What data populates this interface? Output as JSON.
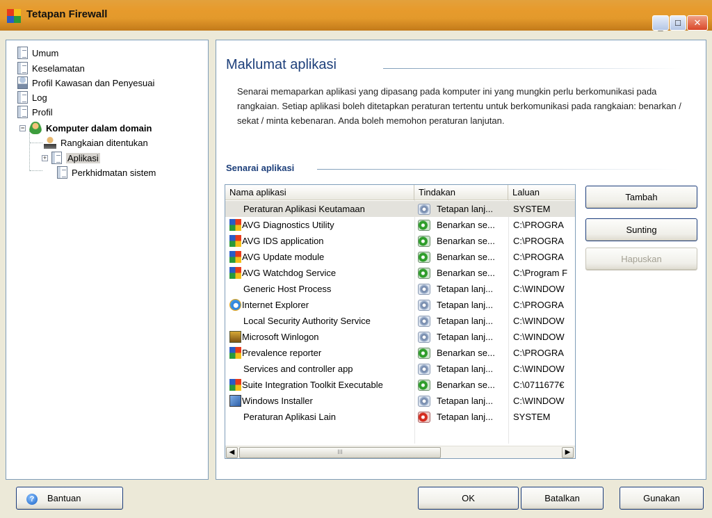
{
  "window": {
    "title": "Tetapan Firewall"
  },
  "tree": {
    "items": [
      {
        "label": "Umum"
      },
      {
        "label": "Keselamatan"
      },
      {
        "label": "Profil Kawasan dan Penyesuai"
      },
      {
        "label": "Log"
      },
      {
        "label": "Profil"
      },
      {
        "label": "Komputer dalam domain"
      },
      {
        "label": "Rangkaian ditentukan"
      },
      {
        "label": "Aplikasi"
      },
      {
        "label": "Perkhidmatan sistem"
      }
    ]
  },
  "main": {
    "title": "Maklumat aplikasi",
    "description": "Senarai memaparkan aplikasi yang dipasang pada komputer ini yang mungkin perlu berkomunikasi pada rangkaian. Setiap aplikasi boleh ditetapkan peraturan tertentu untuk berkomunikasi pada rangkaian: benarkan / sekat / minta kebenaran. Anda boleh memohon peraturan lanjutan.",
    "section_title": "Senarai aplikasi"
  },
  "table": {
    "columns": [
      "Nama aplikasi",
      "Tindakan",
      "Laluan"
    ],
    "rows": [
      {
        "name": "Peraturan Aplikasi Keutamaan",
        "action": "Tetapan lanj...",
        "path": "SYSTEM",
        "icon": "none",
        "action_icon": "gear-icon"
      },
      {
        "name": "AVG Diagnostics Utility",
        "action": "Benarkan se...",
        "path": "C:\\PROGRA",
        "icon": "avg-icon",
        "action_icon": "allow-icon"
      },
      {
        "name": "AVG IDS application",
        "action": "Benarkan se...",
        "path": "C:\\PROGRA",
        "icon": "avg-icon",
        "action_icon": "allow-icon"
      },
      {
        "name": "AVG Update module",
        "action": "Benarkan se...",
        "path": "C:\\PROGRA",
        "icon": "avg-icon",
        "action_icon": "allow-icon"
      },
      {
        "name": "AVG Watchdog Service",
        "action": "Benarkan se...",
        "path": "C:\\Program F",
        "icon": "avg-icon",
        "action_icon": "allow-icon"
      },
      {
        "name": "Generic Host Process",
        "action": "Tetapan lanj...",
        "path": "C:\\WINDOW",
        "icon": "none",
        "action_icon": "gear-icon"
      },
      {
        "name": "Internet Explorer",
        "action": "Tetapan lanj...",
        "path": "C:\\PROGRA",
        "icon": "ie-icon",
        "action_icon": "gear-icon"
      },
      {
        "name": "Local Security Authority Service",
        "action": "Tetapan lanj...",
        "path": "C:\\WINDOW",
        "icon": "none",
        "action_icon": "gear-icon"
      },
      {
        "name": "Microsoft Winlogon",
        "action": "Tetapan lanj...",
        "path": "C:\\WINDOW",
        "icon": "winlogon-icon",
        "action_icon": "gear-icon"
      },
      {
        "name": "Prevalence reporter",
        "action": "Benarkan se...",
        "path": "C:\\PROGRA",
        "icon": "avg-icon",
        "action_icon": "allow-icon"
      },
      {
        "name": "Services and controller app",
        "action": "Tetapan lanj...",
        "path": "C:\\WINDOW",
        "icon": "none",
        "action_icon": "gear-icon"
      },
      {
        "name": "Suite Integration Toolkit Executable",
        "action": "Benarkan se...",
        "path": "C:\\0711677€",
        "icon": "avg-icon",
        "action_icon": "allow-icon"
      },
      {
        "name": "Windows Installer",
        "action": "Tetapan lanj...",
        "path": "C:\\WINDOW",
        "icon": "msi-icon",
        "action_icon": "gear-icon"
      },
      {
        "name": "Peraturan Aplikasi Lain",
        "action": "Tetapan lanj...",
        "path": "SYSTEM",
        "icon": "none",
        "action_icon": "block-icon"
      }
    ]
  },
  "side_buttons": {
    "add": "Tambah",
    "edit": "Sunting",
    "delete": "Hapuskan"
  },
  "footer": {
    "help": "Bantuan",
    "ok": "OK",
    "cancel": "Batalkan",
    "apply": "Gunakan"
  },
  "colors": {
    "accent": "#1d3f7a",
    "titlebar": "#e79b2d",
    "frame": "#ece9d8"
  }
}
